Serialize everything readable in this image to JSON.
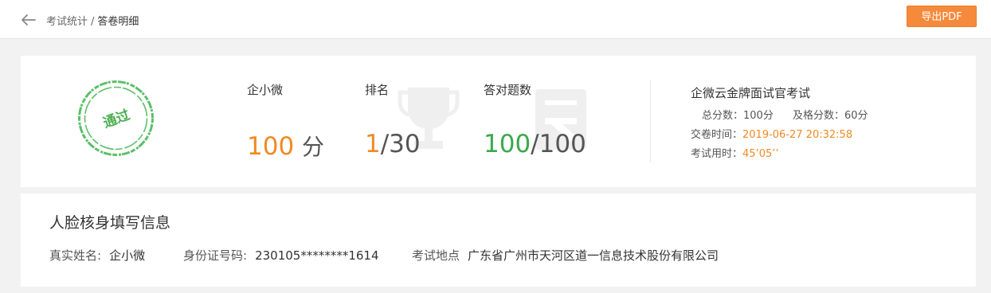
{
  "header": {
    "breadcrumb_parent": "考试统计",
    "breadcrumb_separator": "/",
    "breadcrumb_current": "答卷明细",
    "export_label": "导出PDF"
  },
  "summary": {
    "stamp_text": "通过",
    "name": "企小微",
    "score_value": "100",
    "score_unit": "分",
    "rank_label": "排名",
    "rank_value": "1",
    "rank_total": "/30",
    "correct_label": "答对题数",
    "correct_value": "100",
    "correct_total": "/100"
  },
  "exam": {
    "title": "企微云金牌面试官考试",
    "total_score_label": "总分数：",
    "total_score_value": "100分",
    "pass_score_label": "及格分数：",
    "pass_score_value": "60分",
    "submit_time_label": "交卷时间：",
    "submit_time_value": "2019-06-27 20:32:58",
    "duration_label": "考试用时：",
    "duration_value": "45’05’’"
  },
  "identity": {
    "section_title": "人脸核身填写信息",
    "real_name_label": "真实姓名:",
    "real_name_value": "企小微",
    "id_label": "身份证号码:",
    "id_value": "230105********1614",
    "location_label": "考试地点",
    "location_value": "广东省广州市天河区道一信息技术股份有限公司"
  },
  "colors": {
    "accent_orange": "#f08a24",
    "button_orange": "#f58a3c",
    "pass_green": "#3aa94a"
  },
  "icons": {
    "back": "arrow-left-icon",
    "trophy": "trophy-icon",
    "document": "document-icon"
  }
}
